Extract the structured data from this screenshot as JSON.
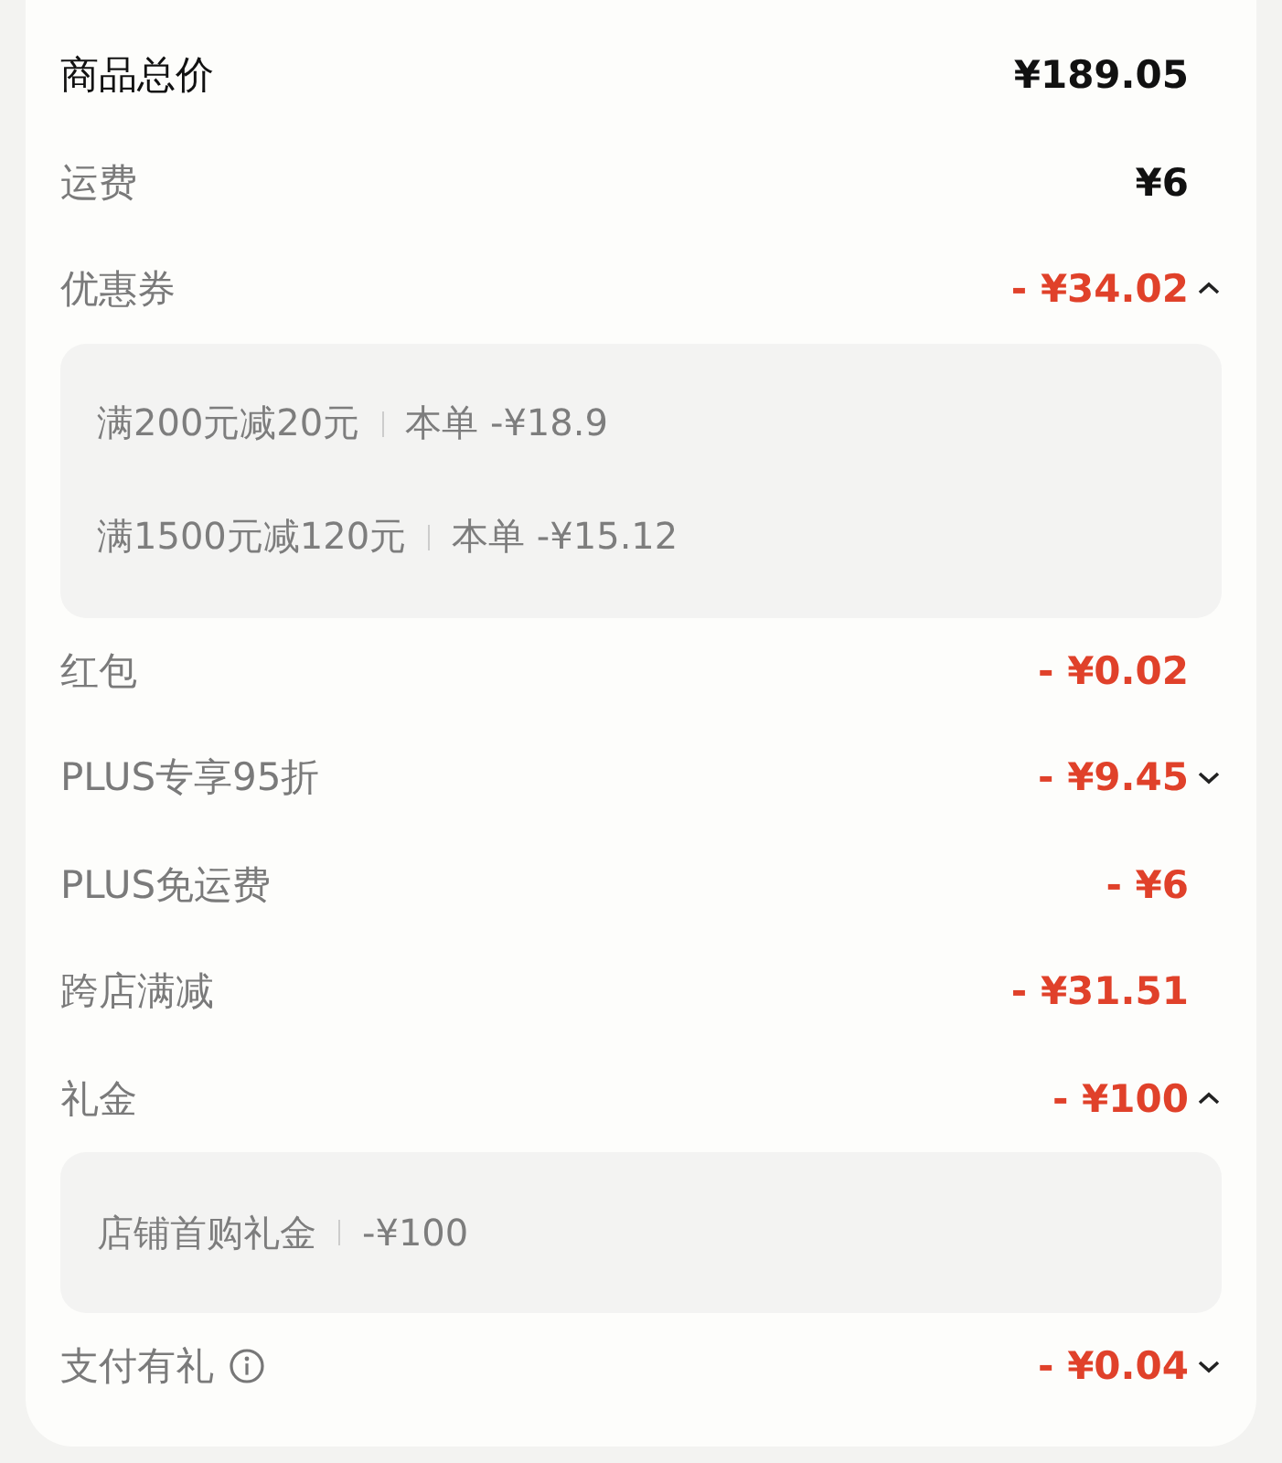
{
  "rows": [
    {
      "label": "商品总价",
      "amount": "¥189.05",
      "kind": "total"
    },
    {
      "label": "运费",
      "amount": "¥6",
      "kind": "charge"
    },
    {
      "label": "优惠券",
      "amount": "- ¥34.02",
      "kind": "discount",
      "expanded": true,
      "details": [
        {
          "name": "满200元减20元",
          "value": "本单 -¥18.9"
        },
        {
          "name": "满1500元减120元",
          "value": "本单 -¥15.12"
        }
      ]
    },
    {
      "label": "红包",
      "amount": "- ¥0.02",
      "kind": "discount"
    },
    {
      "label": "PLUS专享95折",
      "amount": "- ¥9.45",
      "kind": "discount",
      "expanded": false
    },
    {
      "label": "PLUS免运费",
      "amount": "- ¥6",
      "kind": "discount"
    },
    {
      "label": "跨店满减",
      "amount": "- ¥31.51",
      "kind": "discount"
    },
    {
      "label": "礼金",
      "amount": "- ¥100",
      "kind": "discount",
      "expanded": true,
      "details": [
        {
          "name": "店铺首购礼金",
          "value": "-¥100"
        }
      ]
    },
    {
      "label": "支付有礼",
      "amount": "- ¥0.04",
      "kind": "discount",
      "expanded": false,
      "info": true
    }
  ]
}
